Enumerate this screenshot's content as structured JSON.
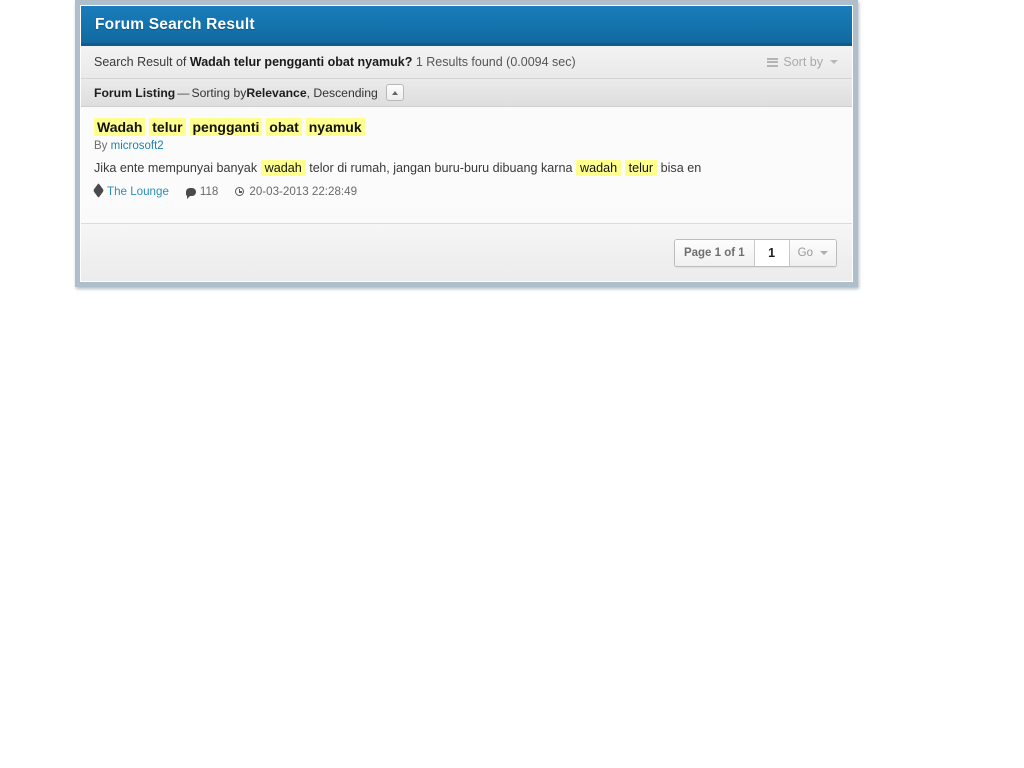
{
  "panel": {
    "titlebar": {
      "title": "Forum Search Result"
    },
    "summary": {
      "prefix": "Search Result of ",
      "query": "Wadah telur pengganti obat nyamuk?",
      "results_text": " 1 Results found (0.0094 sec)",
      "sort_by_label": "Sort by",
      "sort_icon": "list-icon",
      "sort_caret_icon": "caret-down-icon"
    },
    "listing": {
      "heading": "Forum Listing",
      "dash": "—",
      "sorting_prefix": "Sorting by ",
      "sort_field": "Relevance",
      "sort_direction": ", Descending",
      "collapse_icon": "chevron-up-icon"
    },
    "results": [
      {
        "title_parts": [
          {
            "text": "Wadah",
            "highlight": true
          },
          {
            "text": " ",
            "highlight": false
          },
          {
            "text": "telur",
            "highlight": true
          },
          {
            "text": " ",
            "highlight": false
          },
          {
            "text": "pengganti",
            "highlight": true
          },
          {
            "text": " ",
            "highlight": false
          },
          {
            "text": "obat",
            "highlight": true
          },
          {
            "text": " ",
            "highlight": false
          },
          {
            "text": "nyamuk",
            "highlight": true
          }
        ],
        "by_label": "By ",
        "author": "microsoft2",
        "snippet_parts": [
          {
            "text": "Jika ente mempunyai banyak ",
            "highlight": false
          },
          {
            "text": "wadah",
            "highlight": true
          },
          {
            "text": " telor di rumah, jangan buru-buru dibuang karna ",
            "highlight": false
          },
          {
            "text": "wadah",
            "highlight": true
          },
          {
            "text": " ",
            "highlight": false
          },
          {
            "text": "telur",
            "highlight": true
          },
          {
            "text": " bisa en",
            "highlight": false
          }
        ],
        "meta": {
          "forum_icon": "tag-icon",
          "forum": "The Lounge",
          "replies_icon": "comment-icon",
          "replies": "118",
          "date_icon": "clock-icon",
          "date": "20-03-2013 22:28:49"
        }
      }
    ],
    "footer": {
      "page_label": "Page 1 of 1",
      "page_value": "1",
      "go_label": "Go",
      "go_caret_icon": "caret-down-icon"
    }
  },
  "colors": {
    "titlebar": "#1473ad",
    "titlebar_border": "#0f5b8c",
    "frame": "#aebecb",
    "highlight": "#ffff8d",
    "link": "#1e83b5"
  }
}
